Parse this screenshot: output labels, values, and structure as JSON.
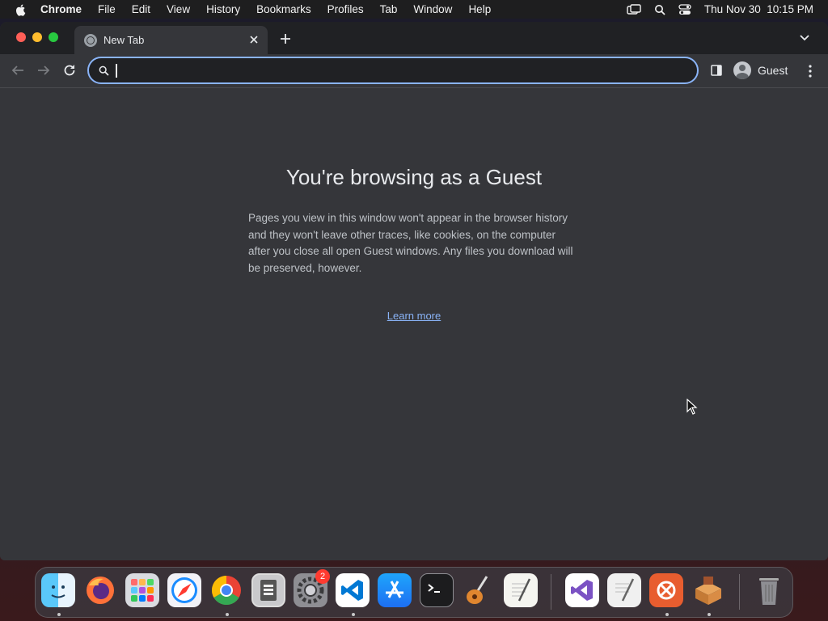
{
  "menubar": {
    "app_name": "Chrome",
    "items": [
      "File",
      "Edit",
      "View",
      "History",
      "Bookmarks",
      "Profiles",
      "Tab",
      "Window",
      "Help"
    ],
    "datetime": "Thu Nov 30  10:15 PM"
  },
  "tabs": [
    {
      "title": "New Tab",
      "active": true
    }
  ],
  "omnibox": {
    "value": "",
    "placeholder": ""
  },
  "profile": {
    "name": "Guest"
  },
  "page": {
    "title": "You're browsing as a Guest",
    "description": "Pages you view in this window won't appear in the browser history and they won't leave other traces, like cookies, on the computer after you close all open Guest windows. Any files you download will be preserved, however.",
    "learn_more": "Learn more"
  },
  "dock": {
    "apps": [
      "finder-icon",
      "firefox-icon",
      "launchpad-icon",
      "safari-icon",
      "chrome-icon",
      "preview-icon",
      "system-settings-icon",
      "vscode-icon",
      "app-store-icon",
      "terminal-icon",
      "instruments-icon",
      "textedit-icon",
      "visual-studio-icon",
      "script-editor-icon",
      "remote-desktop-icon",
      "package-installer-icon",
      "trash-icon"
    ],
    "settings_badge": "2"
  },
  "colors": {
    "accent": "#8ab4f8",
    "window_bg": "#35363a",
    "tabstrip_bg": "#202124"
  }
}
